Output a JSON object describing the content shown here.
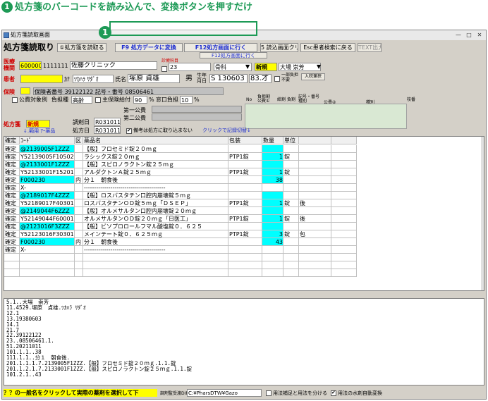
{
  "heading": {
    "num": "1",
    "text": "処方箋のバーコードを読み込んで、変換ボタンを押すだけ"
  },
  "callout": {
    "num": "1"
  },
  "window": {
    "title": "処方箋読取画面",
    "min": "—",
    "max": "□",
    "close": "✕"
  },
  "toolbar": {
    "app_title": "処方箋読取り",
    "read_button": "①処方箋を読取る",
    "f9_button": "F9 処方データに変換",
    "f12_button": "F12処方画面に行く",
    "s5_button": "5 読込画面クリア",
    "esc_button": "Esc患者検索に戻る",
    "text_button": "TEXT出力",
    "hidden_button": "F12処方画面に行く"
  },
  "institution": {
    "label": "医療\n機関",
    "code": "6000005",
    "number": "1111111",
    "name": "佐藤クリニック",
    "dept_label": "診療科目",
    "dept_code": "23",
    "dept_name": "骨科",
    "status": "新規",
    "doctor": "大場 崇芳"
  },
  "patient": {
    "label": "患者",
    "kana_label": "ｶﾅ",
    "kana": "ﾂｶﾊﾗ ｻﾀﾞｵ",
    "name_label": "氏名",
    "name": "塚原 貞雄",
    "sex": "男",
    "birth_label": "生年\n月日",
    "birth": "S 130603",
    "age": "83.才",
    "burden_label": "一部負担\n不要",
    "admit_button": "入院兼狭"
  },
  "insurance": {
    "label": "保険",
    "insurer_label": "保険者番号",
    "insurer": "39122122",
    "symbol_label": "記号・番号",
    "symbol": "08506461",
    "public_label": "公費対象例",
    "burden_label": "負担種",
    "burden": "高齢",
    "benefit_label": "主保険給付",
    "benefit": "90",
    "pct": "%",
    "window_label": "窓口負担",
    "window_pct": "10",
    "pct2": "%",
    "public1": "第一公費",
    "public2": "第二公費",
    "right_headers": [
      "No",
      "負担割\n公費①",
      "給割",
      "負割",
      "記号・番号\n種別",
      "公費②",
      "種別",
      "枝番"
    ]
  },
  "prescription": {
    "label": "処方箋",
    "status": "新規",
    "help": "↓.範用 ｱｰ薬品",
    "issue_label": "調剤日",
    "issue": "R031011",
    "date_label": "処方日",
    "date": "R031011",
    "note_check": "備考は処方に取り込まない",
    "toggle_link": "クリックで記録切替↓"
  },
  "grid": {
    "headers": [
      "確定",
      "ｺｰﾄﾞ",
      "区",
      "薬品名",
      "包装",
      "数量",
      "単位",
      "",
      ""
    ],
    "rows": [
      [
        "確定",
        "@2139005F1ZZZ",
        "",
        "【般】フロセミド錠２０ｍｇ",
        "",
        "",
        "",
        "",
        ""
      ],
      [
        "確定",
        "Y52139005F10502",
        "",
        "ラシックス錠２０ｍｇ",
        "PTP1錠",
        "1",
        "錠",
        "",
        ""
      ],
      [
        "確定",
        "@2133001F1ZZZ",
        "",
        "【般】スピロノラクトン錠２５ｍｇ",
        "",
        "",
        "",
        "",
        ""
      ],
      [
        "確定",
        "Y52133001F15201",
        "",
        "アルダクトンＡ錠２５ｍｇ",
        "PTP1錠",
        "1",
        "錠",
        "",
        ""
      ],
      [
        "確定",
        "F000230",
        "内",
        "分１　朝食後",
        "",
        "38",
        "",
        "",
        ""
      ],
      [
        "確定",
        "X-",
        "",
        "----------------------------------------",
        "",
        "",
        "",
        "",
        ""
      ],
      [
        "確定",
        "@2189017F4ZZZ",
        "",
        "【般】ロスバスタチン口腔内崩壊錠５ｍｇ",
        "",
        "",
        "",
        "",
        ""
      ],
      [
        "確定",
        "Y52189017F40301",
        "",
        "ロスバスタチンＯＤ錠５ｍｇ「ＤＳＥＰ」",
        "PTP1錠",
        "1",
        "錠",
        "後",
        ""
      ],
      [
        "確定",
        "@2149044F6ZZZ",
        "",
        "【般】オルメサルタン口腔内崩壊錠２０ｍｇ",
        "",
        "",
        "",
        "",
        ""
      ],
      [
        "確定",
        "Y52149044F60001",
        "",
        "オルメサルタンＯＤ錠２０ｍｇ「日医工」",
        "PTP1錠",
        "1",
        "錠",
        "後",
        ""
      ],
      [
        "確定",
        "@2123016F3ZZZ",
        "",
        "【般】ビソプロロールフマル酸塩錠０．６２５",
        "",
        "",
        "",
        "",
        ""
      ],
      [
        "確定",
        "Y52123016F30301",
        "",
        "メインテート錠０．６２５ｍｇ",
        "PTP1錠",
        "3",
        "錠",
        "包",
        ""
      ],
      [
        "確定",
        "F000230",
        "内",
        "分１　朝食後",
        "",
        "43",
        "",
        "",
        ""
      ],
      [
        "確定",
        "X-",
        "",
        "----------------------------------------",
        "",
        "",
        "",
        "",
        ""
      ]
    ]
  },
  "memo": {
    "lines": [
      "5.1..大場　崇芳",
      "11.4529.塚原　貞雄.ﾂｶﾊﾗ ｻﾀﾞｵ",
      "12.1",
      "13.19380603",
      "14.1",
      "21.7",
      "22.39122122",
      "23..08506461.1.",
      "51.20211011",
      "101.1.1..38",
      "111.1.1..分１　朝食後.",
      "201.1.1.1.7.2139005F1ZZZ.【般】フロセミド錠２０ｍｇ.1.1.錠",
      "201.1.2.1.7.2133001F1ZZZ.【般】スピロノラクトン錠２５ｍｇ.1.1.錠",
      "101.2.1..43"
    ]
  },
  "status": {
    "hint": "？？の一般名をクリックして実際の薬剤を選択して下",
    "dir_label": "調剤監受渡DIR",
    "dir": "C:¥PharsDTW¥Gazo",
    "check1": "用法補足と用法を分ける",
    "check2": "用法の水剤自動変換"
  },
  "colors": {
    "accent": "#1d9a56",
    "yellow": "#ffff00",
    "cyan": "#00ffff",
    "blue_text": "#1f2fd0"
  }
}
